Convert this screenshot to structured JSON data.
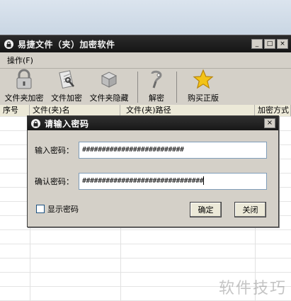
{
  "app": {
    "title": "易捷文件（夹）加密软件",
    "minimize_glyph": "_",
    "maximize_glyph": "□",
    "close_glyph": "×",
    "menu": [
      {
        "label": "操作(F)"
      }
    ]
  },
  "toolbar": {
    "items": [
      {
        "label": "文件夹加密",
        "icon": "folder-lock-icon"
      },
      {
        "label": "文件加密",
        "icon": "file-lock-icon"
      },
      {
        "label": "文件夹隐藏",
        "icon": "box-hide-icon"
      },
      {
        "label": "解密",
        "icon": "unlock-icon"
      },
      {
        "label": "购买正版",
        "icon": "star-icon"
      }
    ]
  },
  "table": {
    "columns": [
      "序号",
      "文件(夹)名",
      "文件(夹)路径",
      "加密方式"
    ]
  },
  "dialog": {
    "title": "请输入密码",
    "close_glyph": "×",
    "password_label": "输入密码：",
    "password_value": "##########################",
    "confirm_label": "确认密码：",
    "confirm_value": "###############################",
    "show_password_label": "显示密码",
    "show_password_checked": false,
    "ok_label": "确定",
    "cancel_label": "关闭"
  },
  "watermark": {
    "text": "软件技巧"
  },
  "colors": {
    "titlebar": "#1b1b1b",
    "face": "#d4d0c8",
    "input_border": "#7f9db9"
  }
}
